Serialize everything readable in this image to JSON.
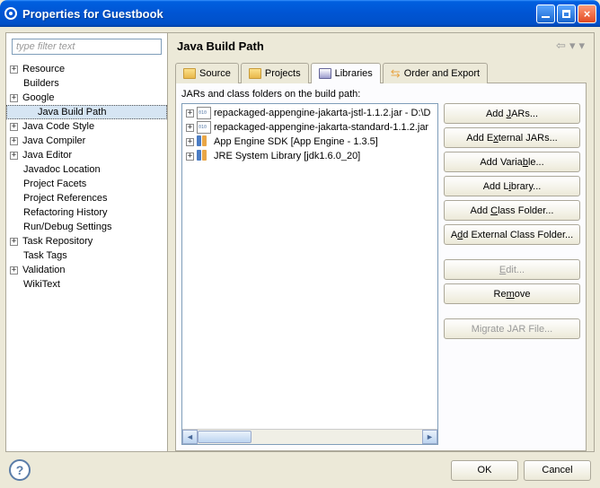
{
  "title": "Properties for Guestbook",
  "filter_placeholder": "type filter text",
  "nav_tree": [
    {
      "label": "Resource",
      "expandable": true,
      "indent": 0
    },
    {
      "label": "Builders",
      "expandable": false,
      "indent": 0
    },
    {
      "label": "Google",
      "expandable": true,
      "indent": 0
    },
    {
      "label": "Java Build Path",
      "expandable": false,
      "indent": 1,
      "selected": true
    },
    {
      "label": "Java Code Style",
      "expandable": true,
      "indent": 0
    },
    {
      "label": "Java Compiler",
      "expandable": true,
      "indent": 0
    },
    {
      "label": "Java Editor",
      "expandable": true,
      "indent": 0
    },
    {
      "label": "Javadoc Location",
      "expandable": false,
      "indent": 0
    },
    {
      "label": "Project Facets",
      "expandable": false,
      "indent": 0
    },
    {
      "label": "Project References",
      "expandable": false,
      "indent": 0
    },
    {
      "label": "Refactoring History",
      "expandable": false,
      "indent": 0
    },
    {
      "label": "Run/Debug Settings",
      "expandable": false,
      "indent": 0
    },
    {
      "label": "Task Repository",
      "expandable": true,
      "indent": 0
    },
    {
      "label": "Task Tags",
      "expandable": false,
      "indent": 0
    },
    {
      "label": "Validation",
      "expandable": true,
      "indent": 0
    },
    {
      "label": "WikiText",
      "expandable": false,
      "indent": 0
    }
  ],
  "page_title": "Java Build Path",
  "tabs": {
    "source": "Source",
    "projects": "Projects",
    "libraries": "Libraries",
    "order": "Order and Export"
  },
  "sub_label": "JARs and class folders on the build path:",
  "lib_items": [
    {
      "label": "repackaged-appengine-jakarta-jstl-1.1.2.jar - D:\\D",
      "icon": "jar"
    },
    {
      "label": "repackaged-appengine-jakarta-standard-1.1.2.jar",
      "icon": "jar"
    },
    {
      "label": "App Engine SDK [App Engine - 1.3.5]",
      "icon": "lib"
    },
    {
      "label": "JRE System Library [jdk1.6.0_20]",
      "icon": "lib"
    }
  ],
  "buttons": {
    "add_jars": "Add JARs...",
    "add_ext_jars": "Add External JARs...",
    "add_variable": "Add Variable...",
    "add_library": "Add Library...",
    "add_class_folder": "Add Class Folder...",
    "add_ext_class_folder": "Add External Class Folder...",
    "edit": "Edit...",
    "remove": "Remove",
    "migrate": "Migrate JAR File..."
  },
  "bottom": {
    "ok": "OK",
    "cancel": "Cancel"
  }
}
